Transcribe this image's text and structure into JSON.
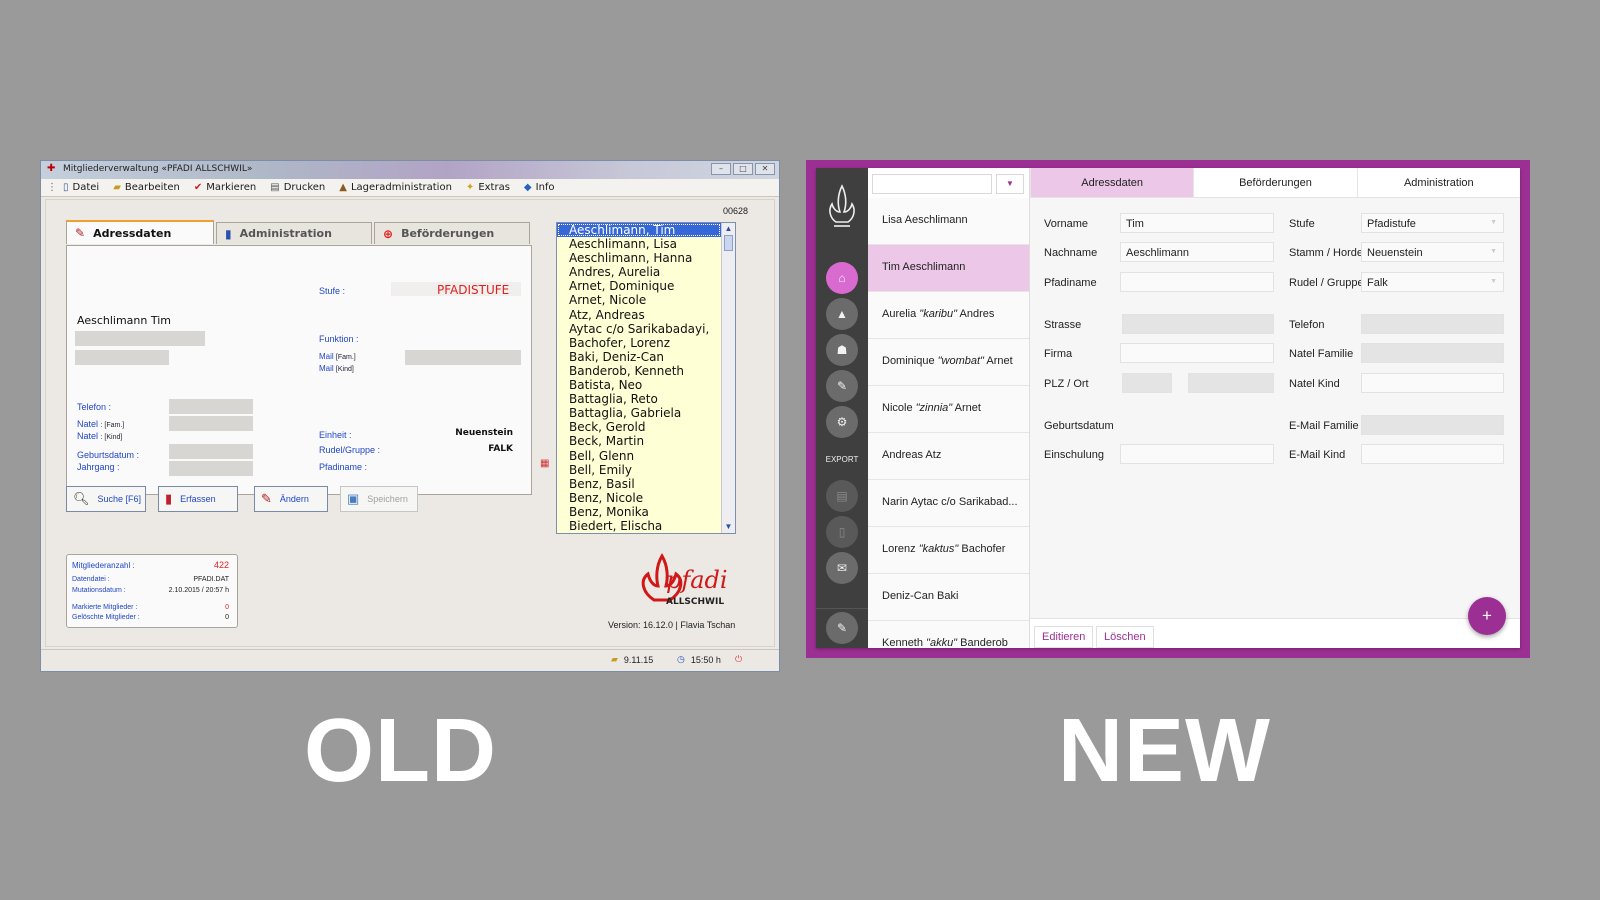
{
  "old": {
    "window_title": "Mitgliederverwaltung  «PFADI ALLSCHWIL»",
    "menu": [
      {
        "label": "Datei",
        "icon": "document-icon"
      },
      {
        "label": "Bearbeiten",
        "icon": "folder-icon"
      },
      {
        "label": "Markieren",
        "icon": "checkmark-icon"
      },
      {
        "label": "Drucken",
        "icon": "printer-icon"
      },
      {
        "label": "Lageradministration",
        "icon": "tent-icon"
      },
      {
        "label": "Extras",
        "icon": "wand-icon"
      },
      {
        "label": "Info",
        "icon": "info-icon"
      }
    ],
    "record_number": "00628",
    "tabs": [
      {
        "label": "Adressdaten",
        "icon": "edit-icon"
      },
      {
        "label": "Administration",
        "icon": "book-icon"
      },
      {
        "label": "Beförderungen",
        "icon": "plus-circle-icon"
      }
    ],
    "form": {
      "name": "Aeschlimann  Tim",
      "stufe_label": "Stufe :",
      "stufe_value": "PFADISTUFE",
      "funktion_label": "Funktion :",
      "mail_label": "Mail",
      "mail_fam": "[Fam.]",
      "mail_kind": "[Kind]",
      "telefon_label": "Telefon :",
      "natel_label": "Natel",
      "natel_fam": ": [Fam.]",
      "natel_kind": ": [Kind]",
      "geburtsdatum_label": "Geburtsdatum :",
      "jahrgang_label": "Jahrgang :",
      "einheit_label": "Einheit :",
      "einheit_value": "Neuenstein",
      "rudel_label": "Rudel/Gruppe :",
      "rudel_value": "FALK",
      "pfadiname_label": "Pfadiname :"
    },
    "members": [
      "Aeschlimann, Tim",
      "Aeschlimann, Lisa",
      "Aeschlimann, Hanna",
      "Andres, Aurelia",
      "Arnet, Dominique",
      "Arnet, Nicole",
      "Atz, Andreas",
      "Aytac c/o Sarikabadayi,",
      "Bachofer, Lorenz",
      "Baki, Deniz-Can",
      "Banderob, Kenneth",
      "Batista, Neo",
      "Battaglia, Reto",
      "Battaglia, Gabriela",
      "Beck, Gerold",
      "Beck, Martin",
      "Bell, Glenn",
      "Bell, Emily",
      "Benz, Basil",
      "Benz, Nicole",
      "Benz, Monika",
      "Biedert, Elischa"
    ],
    "selected_member": 0,
    "buttons": [
      {
        "label": "Suche [F6]",
        "icon": "magnifier-icon"
      },
      {
        "label": "Erfassen",
        "icon": "book-icon"
      },
      {
        "label": "Ändern",
        "icon": "edit-icon"
      },
      {
        "label": "Speichern",
        "icon": "save-icon"
      }
    ],
    "stats": {
      "mitgliederanzahl_label": "Mitgliederanzahl :",
      "mitgliederanzahl": "422",
      "datendatei_label": "Datendatei :",
      "datendatei": "PFADI.DAT",
      "mutationsdatum_label": "Mutationsdatum :",
      "mutationsdatum": "2.10.2015 / 20:57 h",
      "markierte_label": "Markierte Mitglieder :",
      "markierte": "0",
      "geloeschte_label": "Gelöschte Mitglieder :",
      "geloeschte": "0"
    },
    "logo_text": "pfadi",
    "logo_subtext": "ALLSCHWIL",
    "version": "Version:  16.12.0   |   Flavia Tschan",
    "status": {
      "date": "9.11.15",
      "time": "15:50 h"
    }
  },
  "new": {
    "nav": {
      "export_label": "EXPORT"
    },
    "search": {
      "value": "",
      "filter_icon": "filter-icon"
    },
    "people": [
      {
        "pre": "Lisa Aeschlimann",
        "nick": "",
        "post": ""
      },
      {
        "pre": "Tim Aeschlimann",
        "nick": "",
        "post": ""
      },
      {
        "pre": "Aurelia ",
        "nick": "\"karibu\"",
        "post": " Andres"
      },
      {
        "pre": "Dominique ",
        "nick": "\"wombat\"",
        "post": " Arnet"
      },
      {
        "pre": "Nicole ",
        "nick": "\"zinnia\"",
        "post": " Arnet"
      },
      {
        "pre": "Andreas Atz",
        "nick": "",
        "post": ""
      },
      {
        "pre": "Narin Aytac c/o Sarikabad...",
        "nick": "",
        "post": ""
      },
      {
        "pre": "Lorenz ",
        "nick": "\"kaktus\"",
        "post": " Bachofer"
      },
      {
        "pre": "Deniz-Can Baki",
        "nick": "",
        "post": ""
      },
      {
        "pre": "Kenneth ",
        "nick": "\"akku\"",
        "post": " Banderob"
      }
    ],
    "selected_person": 1,
    "tabs": [
      "Adressdaten",
      "Beförderungen",
      "Administration"
    ],
    "form": {
      "vorname_label": "Vorname",
      "vorname": "Tim",
      "nachname_label": "Nachname",
      "nachname": "Aeschlimann",
      "pfadiname_label": "Pfadiname",
      "pfadiname": "",
      "strasse_label": "Strasse",
      "firma_label": "Firma",
      "plz_label": "PLZ / Ort",
      "geburtsdatum_label": "Geburtsdatum",
      "einschulung_label": "Einschulung",
      "stufe_label": "Stufe",
      "stufe": "Pfadistufe",
      "stamm_label": "Stamm / Horde",
      "stamm": "Neuenstein",
      "rudel_label": "Rudel / Gruppe",
      "rudel": "Falk",
      "telefon_label": "Telefon",
      "natel_familie_label": "Natel Familie",
      "natel_kind_label": "Natel Kind",
      "email_familie_label": "E-Mail Familie",
      "email_kind_label": "E-Mail Kind"
    },
    "buttons": {
      "edit": "Editieren",
      "delete": "Löschen",
      "add": "+"
    }
  },
  "captions": {
    "old": "OLD",
    "new": "NEW"
  },
  "colors": {
    "accent": "#9c2f93",
    "selection": "#edc7e8",
    "old_selection": "#3568d6",
    "old_list_bg": "#ffffd5"
  }
}
